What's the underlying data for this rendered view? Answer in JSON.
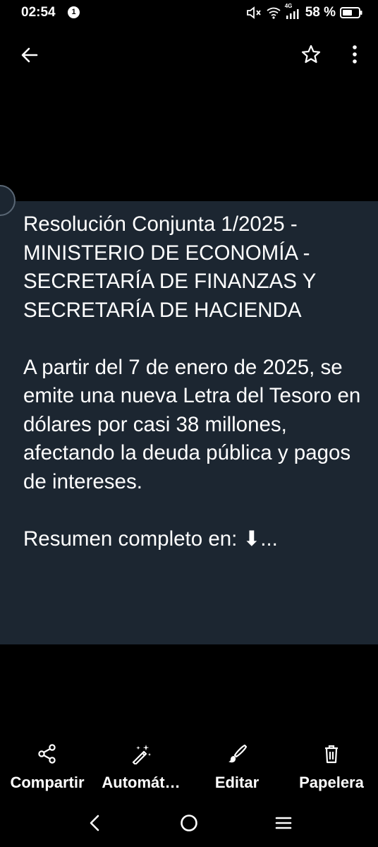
{
  "status_bar": {
    "time": "02:54",
    "notification_count": "1",
    "network_type": "4G",
    "battery": "58 %"
  },
  "toolbar": {
    "back_icon": "arrow-left-icon",
    "star_icon": "star-outline-icon",
    "more_icon": "more-vert-icon"
  },
  "post": {
    "text": "Resolución Conjunta 1/2025 - MINISTERIO DE ECONOMÍA - SECRETARÍA DE FINANZAS Y SECRETARÍA DE HACIENDA\n\nA partir del 7 de enero de 2025, se emite una nueva Letra del Tesoro en dólares por casi 38 millones, afectando la deuda pública y pagos de intereses.\n\nResumen completo en: ⬇..."
  },
  "actions": [
    {
      "label": "Compartir",
      "icon": "share-icon"
    },
    {
      "label": "Automát…",
      "icon": "magic-wand-icon"
    },
    {
      "label": "Editar",
      "icon": "brush-icon"
    },
    {
      "label": "Papelera",
      "icon": "trash-icon"
    }
  ],
  "colors": {
    "background": "#000000",
    "card": "#1c2631",
    "text": "#ffffff"
  }
}
